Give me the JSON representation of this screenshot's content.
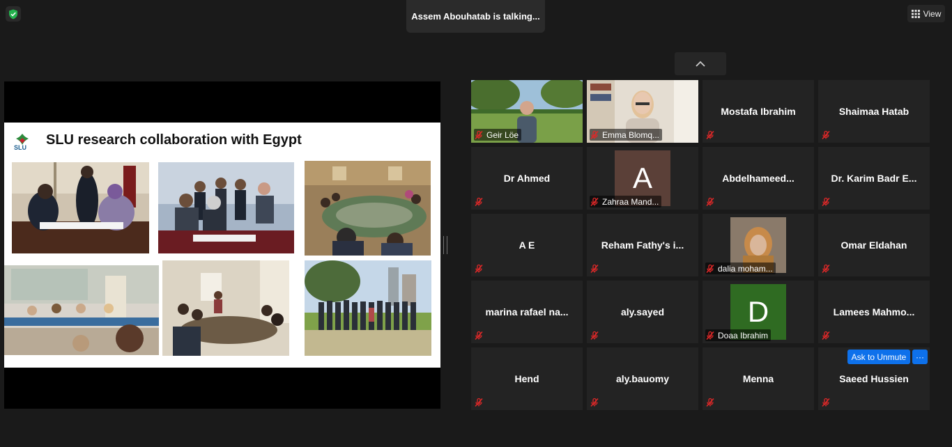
{
  "topbar": {
    "talking": "Assem Abouhatab is talking...",
    "view_label": "View"
  },
  "slide": {
    "title": "SLU research collaboration with Egypt",
    "logo_text": "SLU"
  },
  "participants": [
    {
      "name": "Geir Löe",
      "type": "video"
    },
    {
      "name": "Emma Blomq...",
      "type": "video"
    },
    {
      "name": "Mostafa Ibrahim",
      "type": "name"
    },
    {
      "name": "Shaimaa Hatab",
      "type": "name"
    },
    {
      "name": "Dr Ahmed",
      "type": "name"
    },
    {
      "name": "Zahraa Mand...",
      "type": "avatar",
      "initial": "A",
      "color": "#5b4038"
    },
    {
      "name": "Abdelhameed...",
      "type": "name"
    },
    {
      "name": "Dr. Karim Badr E...",
      "type": "name"
    },
    {
      "name": "A E",
      "type": "name"
    },
    {
      "name": "Reham Fathy's i...",
      "type": "name"
    },
    {
      "name": "dalia moham...",
      "type": "photo"
    },
    {
      "name": "Omar Eldahan",
      "type": "name"
    },
    {
      "name": "marina rafael na...",
      "type": "name"
    },
    {
      "name": "aly.sayed",
      "type": "name"
    },
    {
      "name": "Doaa Ibrahim",
      "type": "avatar",
      "initial": "D",
      "color": "#2f6b22"
    },
    {
      "name": "Lamees Mahmo...",
      "type": "name"
    },
    {
      "name": "Hend",
      "type": "name"
    },
    {
      "name": "aly.bauomy",
      "type": "name"
    },
    {
      "name": "Menna",
      "type": "name"
    },
    {
      "name": "Saeed Hussien",
      "type": "name"
    }
  ],
  "actions": {
    "ask_to_unmute": "Ask to Unmute",
    "more": "···"
  },
  "colors": {
    "background": "#1a1a1a",
    "tile": "#232323",
    "accent": "#0e71eb",
    "muted_red": "#e02828"
  }
}
